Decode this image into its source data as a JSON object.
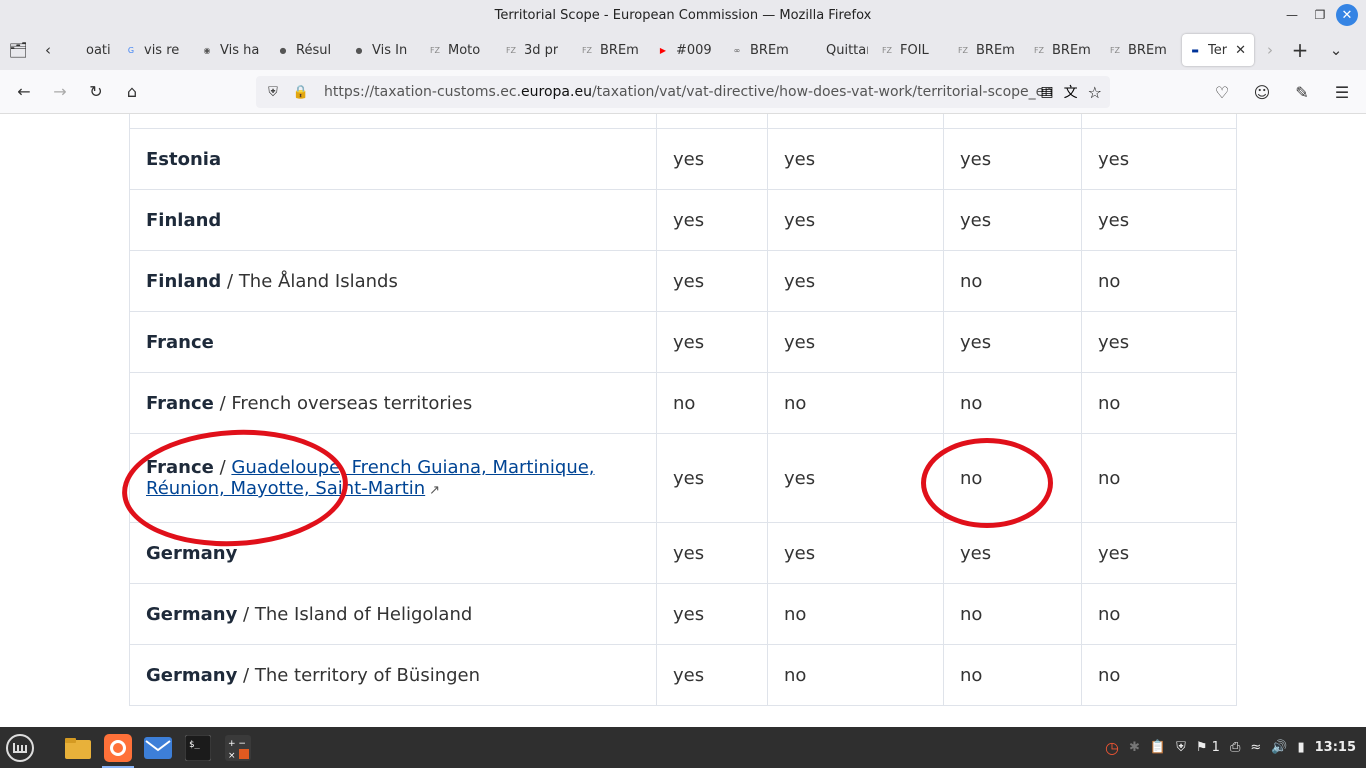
{
  "window": {
    "title": "Territorial Scope - European Commission — Mozilla Firefox"
  },
  "tabs": [
    {
      "label": "oati",
      "icon": "page-icon"
    },
    {
      "label": "vis re",
      "icon": "google-icon"
    },
    {
      "label": "Vis ha",
      "icon": "openai-icon"
    },
    {
      "label": "Résul",
      "icon": "search-icon"
    },
    {
      "label": "Vis In",
      "icon": "search-icon"
    },
    {
      "label": "Moto",
      "icon": "foilzone-icon"
    },
    {
      "label": "3d pr",
      "icon": "foilzone-icon"
    },
    {
      "label": "BREm",
      "icon": "foilzone-icon"
    },
    {
      "label": "#009",
      "icon": "youtube-icon"
    },
    {
      "label": "BREm",
      "icon": "brem-icon"
    },
    {
      "label": "Quittanc",
      "icon": "page-icon"
    },
    {
      "label": "FOIL",
      "icon": "foilzone-icon"
    },
    {
      "label": "BREm",
      "icon": "foilzone-icon"
    },
    {
      "label": "BREm",
      "icon": "foilzone-icon"
    },
    {
      "label": "BREm",
      "icon": "foilzone-icon"
    },
    {
      "label": "Ter",
      "icon": "eu-icon",
      "active": true
    }
  ],
  "navbar": {
    "url_prefix": "https://taxation-customs.ec.",
    "url_domain": "europa.eu",
    "url_path": "/taxation/vat/vat-directive/how-does-vat-work/territorial-scope_en"
  },
  "table": {
    "rows": [
      {
        "country": "Estonia",
        "sep": "",
        "region": "",
        "link": false,
        "values": [
          "yes",
          "yes",
          "yes",
          "yes"
        ]
      },
      {
        "country": "Finland",
        "sep": "",
        "region": "",
        "link": false,
        "values": [
          "yes",
          "yes",
          "yes",
          "yes"
        ]
      },
      {
        "country": "Finland",
        "sep": " / ",
        "region": "The Åland Islands",
        "link": false,
        "values": [
          "yes",
          "yes",
          "no",
          "no"
        ]
      },
      {
        "country": "France",
        "sep": "",
        "region": "",
        "link": false,
        "values": [
          "yes",
          "yes",
          "yes",
          "yes"
        ]
      },
      {
        "country": "France",
        "sep": " / ",
        "region": "French overseas territories",
        "link": false,
        "values": [
          "no",
          "no",
          "no",
          "no"
        ]
      },
      {
        "country": "France",
        "sep": " / ",
        "region": "Guadeloupe, French Guiana, Martinique, Réunion, Mayotte, Saint-Martin",
        "link": true,
        "values": [
          "yes",
          "yes",
          "no",
          "no"
        ]
      },
      {
        "country": "Germany",
        "sep": "",
        "region": "",
        "link": false,
        "values": [
          "yes",
          "yes",
          "yes",
          "yes"
        ]
      },
      {
        "country": "Germany",
        "sep": " / ",
        "region": "The Island of Heligoland",
        "link": false,
        "values": [
          "yes",
          "no",
          "no",
          "no"
        ]
      },
      {
        "country": "Germany",
        "sep": " / ",
        "region": "The territory of Büsingen",
        "link": false,
        "values": [
          "yes",
          "no",
          "no",
          "no"
        ]
      }
    ]
  },
  "taskbar": {
    "clock": "13:15",
    "notification_count": "1"
  },
  "colors": {
    "annotation_red": "#e0101a",
    "link_blue": "#004494"
  }
}
